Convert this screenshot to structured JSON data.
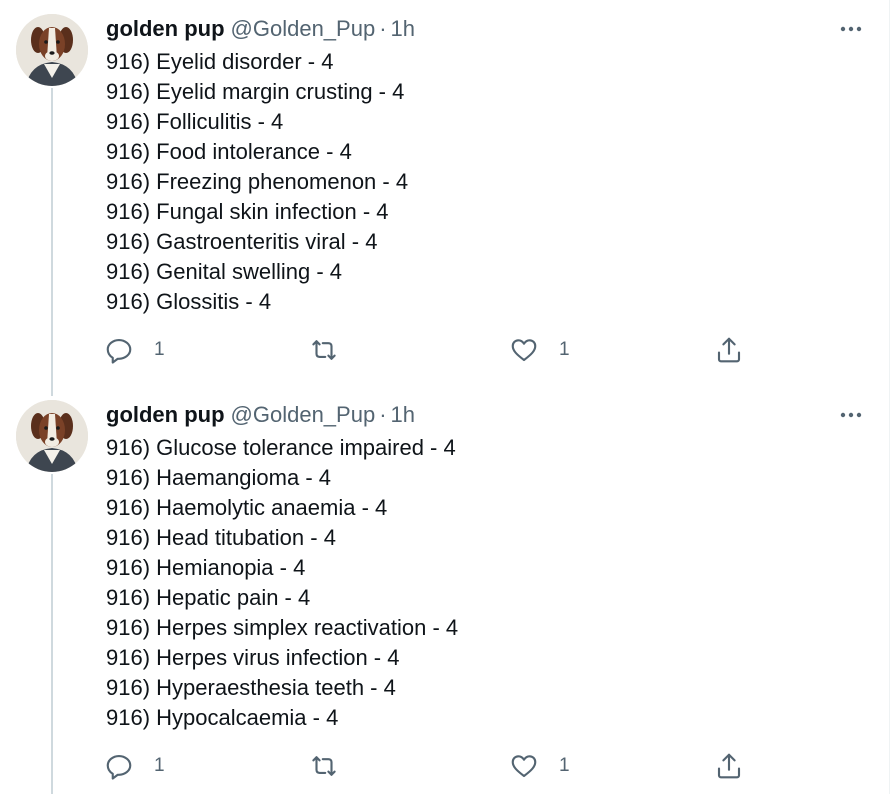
{
  "tweets": [
    {
      "author": {
        "name": "golden pup",
        "handle": "@Golden_Pup",
        "avatar_icon": "dog-avatar-icon"
      },
      "separator": "·",
      "time": "1h",
      "lines": [
        "916) Eyelid disorder - 4",
        "916) Eyelid margin crusting - 4",
        "916) Folliculitis - 4",
        "916) Food intolerance - 4",
        "916) Freezing phenomenon - 4",
        "916) Fungal skin infection - 4",
        "916) Gastroenteritis viral - 4",
        "916) Genital swelling - 4",
        "916) Glossitis - 4"
      ],
      "actions": {
        "reply_count": "1",
        "retweet_count": "",
        "like_count": "1"
      }
    },
    {
      "author": {
        "name": "golden pup",
        "handle": "@Golden_Pup",
        "avatar_icon": "dog-avatar-icon"
      },
      "separator": "·",
      "time": "1h",
      "lines": [
        "916) Glucose tolerance impaired - 4",
        "916) Haemangioma - 4",
        "916) Haemolytic anaemia - 4",
        "916) Head titubation - 4",
        "916) Hemianopia - 4",
        "916) Hepatic pain - 4",
        "916) Herpes simplex reactivation - 4",
        "916) Herpes virus infection - 4",
        "916) Hyperaesthesia teeth - 4",
        "916) Hypocalcaemia - 4"
      ],
      "actions": {
        "reply_count": "1",
        "retweet_count": "",
        "like_count": "1"
      }
    }
  ],
  "colors": {
    "text_primary": "#0f1419",
    "text_secondary": "#536471",
    "thread_line": "#cfd9de",
    "border": "#eff3f4"
  },
  "icons": [
    "more-icon",
    "reply-icon",
    "retweet-icon",
    "like-icon",
    "share-icon"
  ]
}
